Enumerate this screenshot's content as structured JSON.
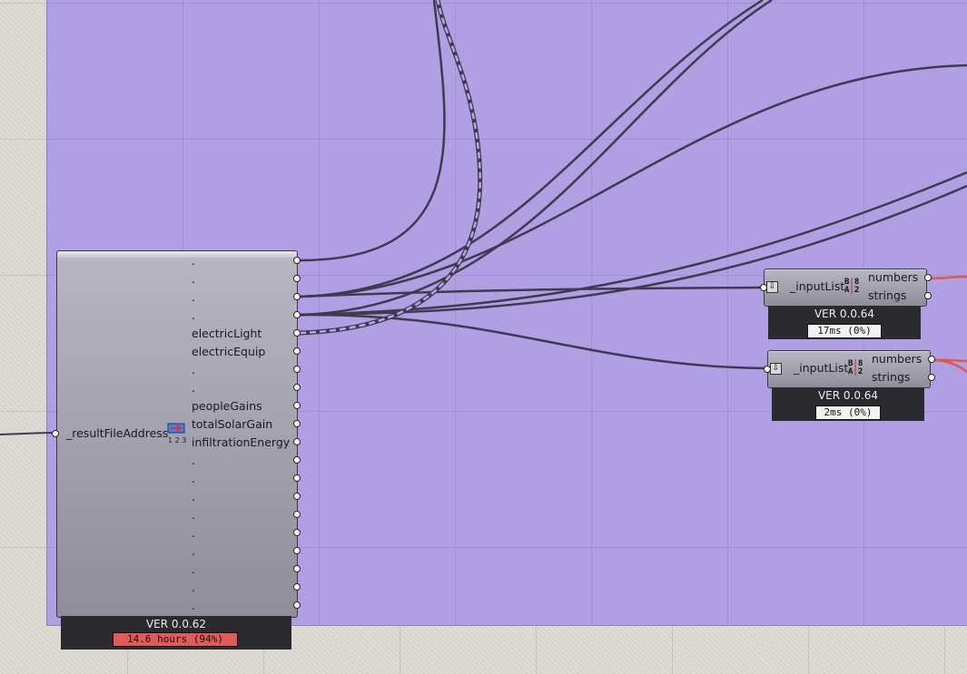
{
  "app": "Grasshopper canvas",
  "main_component": {
    "input_label": "_resultFileAddress",
    "outputs": [
      ".",
      ".",
      ".",
      ".",
      "electricLight",
      "electricEquip",
      ".",
      ".",
      "peopleGains",
      "totalSolarGain",
      "infiltrationEnergy",
      ".",
      ".",
      ".",
      ".",
      ".",
      ".",
      ".",
      ".",
      "."
    ],
    "version": "VER 0.0.62",
    "timer": "14.6 hours (94%)",
    "icon": "list-123-icon"
  },
  "input_list_1": {
    "label": "_inputList",
    "outputs": [
      "numbers",
      "strings"
    ],
    "version": "VER 0.0.64",
    "timer": "17ms (0%)"
  },
  "input_list_2": {
    "label": "_inputList",
    "outputs": [
      "numbers",
      "strings"
    ],
    "version": "VER 0.0.64",
    "timer": "2ms (0%)"
  },
  "colors": {
    "group_fill": "#b19fe3",
    "wire": "#3f3a4e",
    "hot_timer": "#e05a5a",
    "output_wire": "#e0584a"
  }
}
